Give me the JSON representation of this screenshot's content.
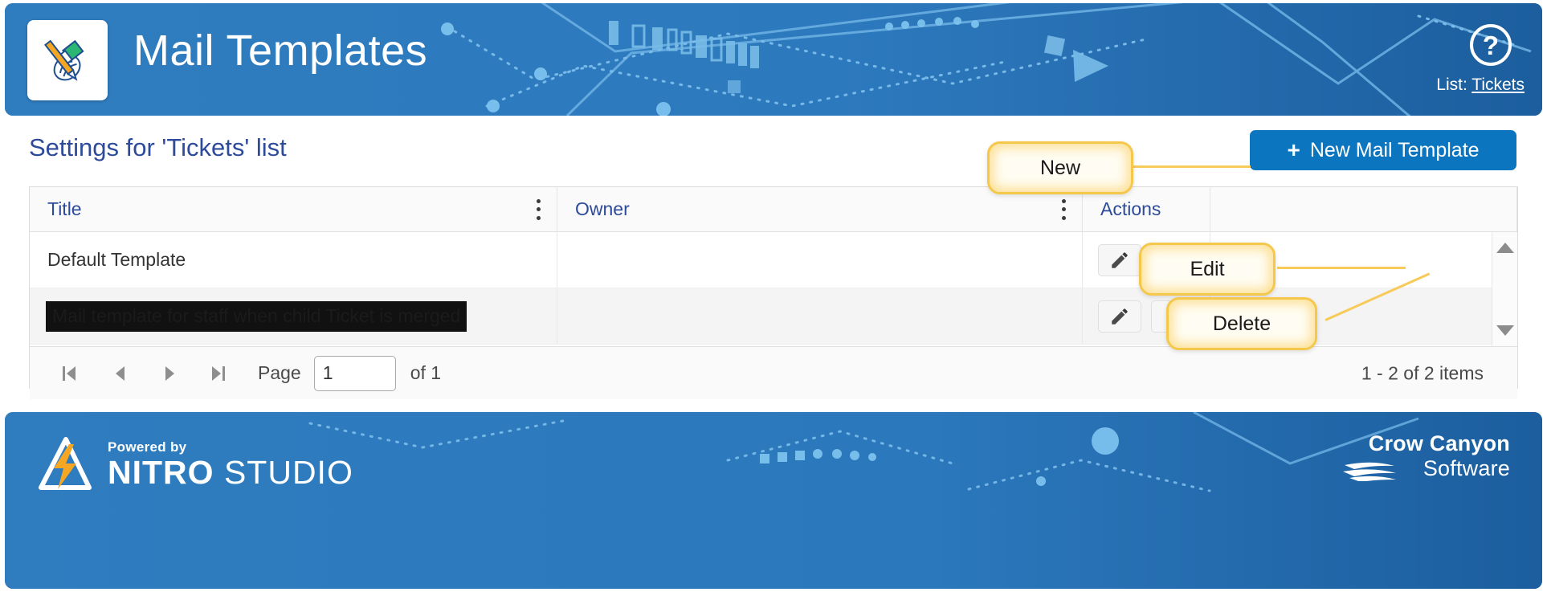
{
  "header": {
    "title": "Mail Templates",
    "app_icon_name": "pencil-eraser-icon",
    "help_icon_name": "question-mark-help-icon",
    "list_prefix": "List:",
    "list_name": "Tickets"
  },
  "main": {
    "settings_title": "Settings for 'Tickets' list",
    "new_button": {
      "plus": "+",
      "label": "New Mail Template"
    },
    "grid": {
      "columns": [
        {
          "label": "Title"
        },
        {
          "label": "Owner"
        },
        {
          "label": "Actions"
        }
      ],
      "rows": [
        {
          "title": "Default Template",
          "owner": "",
          "redacted": false
        },
        {
          "title": "Mail template for staff when child Ticket is merged",
          "owner": "",
          "redacted": true
        }
      ],
      "action_icons": {
        "edit": "pencil-edit-icon",
        "delete": "close-x-delete-icon"
      }
    },
    "pager": {
      "first_title": "Go to the first page",
      "prev_title": "Go to the previous page",
      "next_title": "Go to the next page",
      "last_title": "Go to the last page",
      "page_label": "Page",
      "page_value": "1",
      "page_placeholder": "",
      "of_label": "of 1",
      "items_label": "1 - 2 of 2 items"
    }
  },
  "callouts": [
    {
      "id": "new",
      "label": "New"
    },
    {
      "id": "edit",
      "label": "Edit"
    },
    {
      "id": "delete",
      "label": "Delete"
    }
  ],
  "footer": {
    "powered_by": "Powered by",
    "nitro_bold": "NITRO",
    "nitro_light": " STUDIO",
    "crow_line1": "Crow Canyon",
    "crow_line2": "Software"
  },
  "colors": {
    "header_blue": "#2f7cbf",
    "accent_button": "#0b76bf",
    "heading_navy": "#2d4b9a",
    "callout_border": "#f5c84c",
    "callout_fill": "#fffdf3",
    "redaction_black": "#111111",
    "grid_header_bg": "#fafafa",
    "alt_row_bg": "#f4f4f4"
  }
}
